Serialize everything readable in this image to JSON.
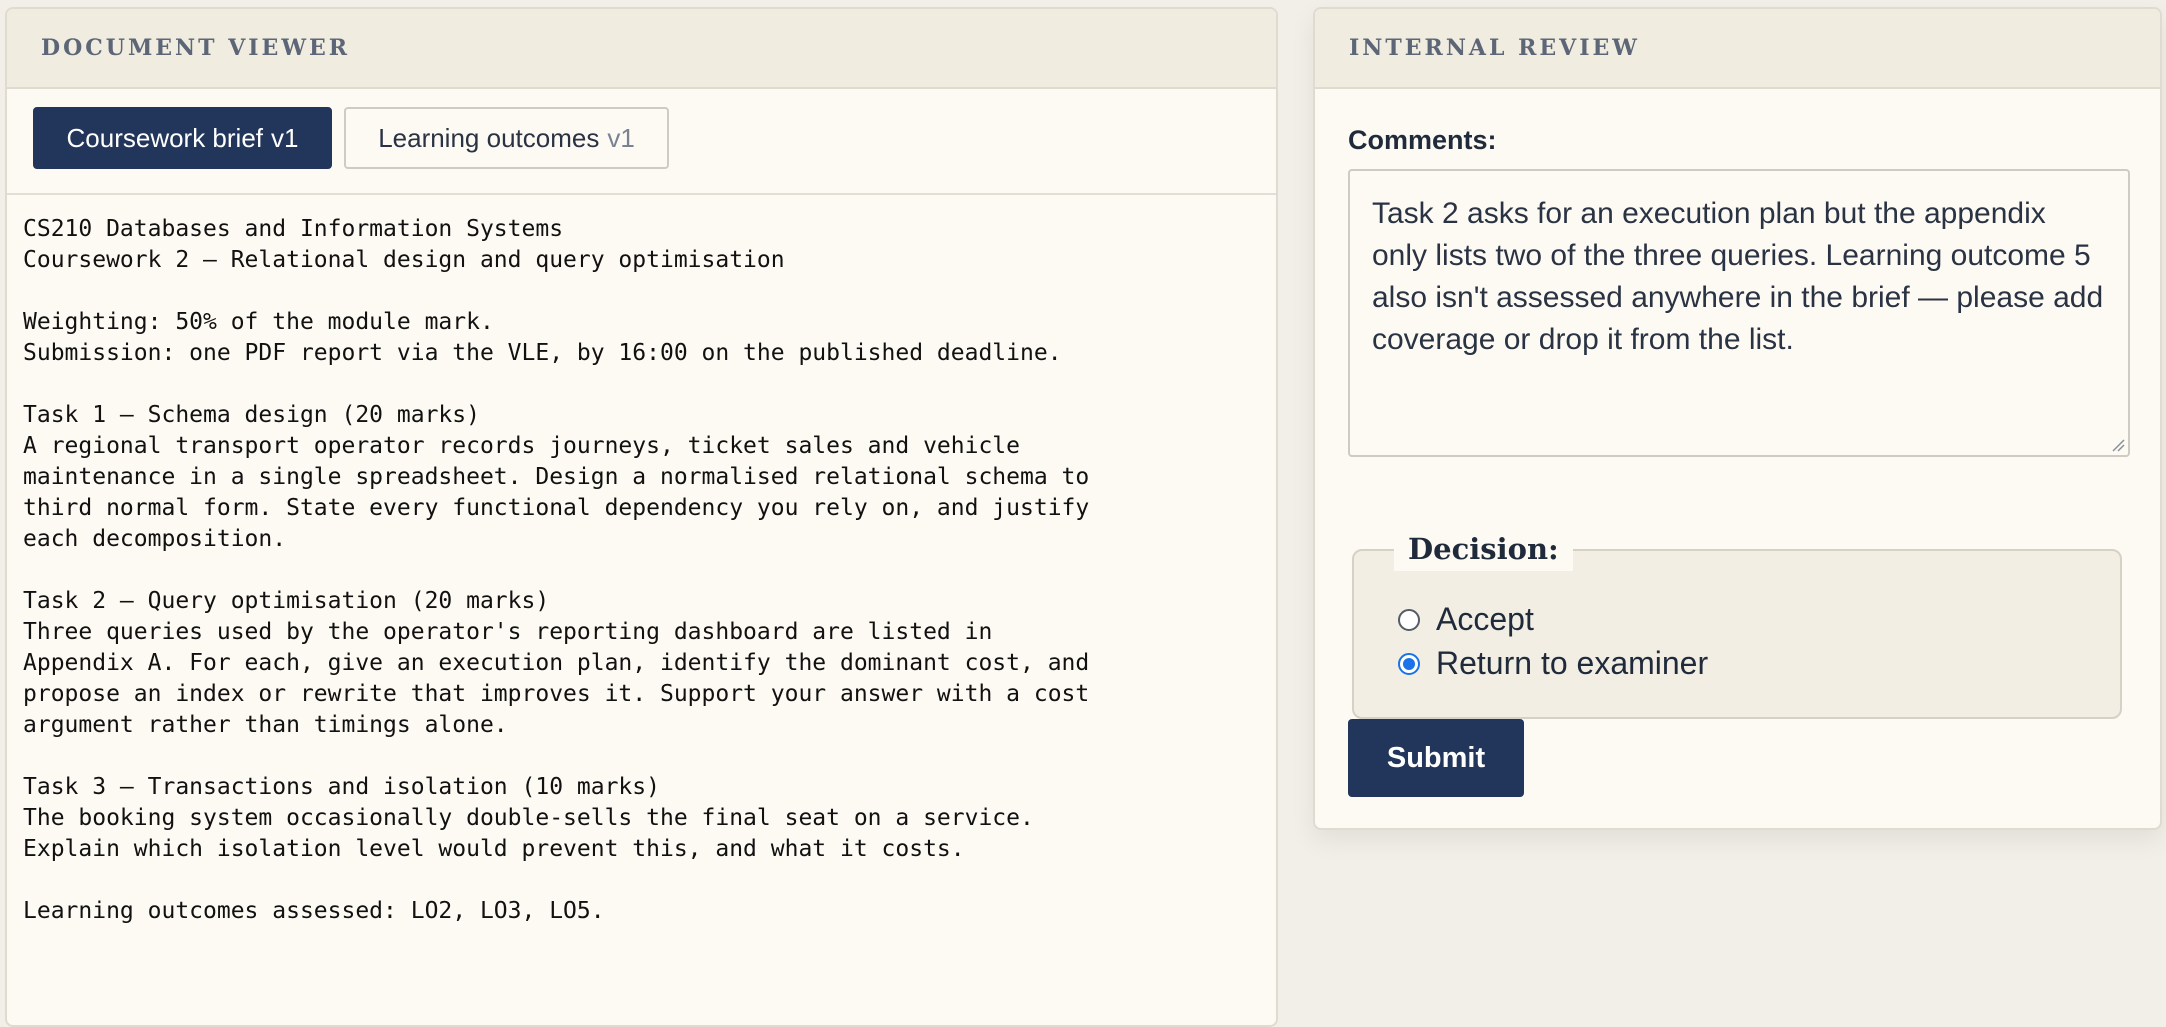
{
  "doc_viewer": {
    "title": "DOCUMENT VIEWER",
    "tabs": [
      {
        "label": "Coursework brief",
        "version": "v1",
        "active": true
      },
      {
        "label": "Learning outcomes",
        "version": "v1",
        "active": false
      }
    ],
    "content": "CS210 Databases and Information Systems\nCoursework 2 — Relational design and query optimisation\n\nWeighting: 50% of the module mark.\nSubmission: one PDF report via the VLE, by 16:00 on the published deadline.\n\nTask 1 — Schema design (20 marks)\nA regional transport operator records journeys, ticket sales and vehicle\nmaintenance in a single spreadsheet. Design a normalised relational schema to\nthird normal form. State every functional dependency you rely on, and justify\neach decomposition.\n\nTask 2 — Query optimisation (20 marks)\nThree queries used by the operator's reporting dashboard are listed in\nAppendix A. For each, give an execution plan, identify the dominant cost, and\npropose an index or rewrite that improves it. Support your answer with a cost\nargument rather than timings alone.\n\nTask 3 — Transactions and isolation (10 marks)\nThe booking system occasionally double-sells the final seat on a service.\nExplain which isolation level would prevent this, and what it costs.\n\nLearning outcomes assessed: LO2, LO3, LO5."
  },
  "review": {
    "title": "INTERNAL REVIEW",
    "comments_label": "Comments:",
    "comments_value": "Task 2 asks for an execution plan but the appendix only lists two of the three queries. Learning outcome 5 also isn't assessed anywhere in the brief — please add coverage or drop it from the list.",
    "decision": {
      "legend": "Decision:",
      "options": [
        {
          "label": "Accept",
          "checked": false
        },
        {
          "label": "Return to examiner",
          "checked": true
        }
      ]
    },
    "submit_label": "Submit"
  },
  "colors": {
    "page_bg": "#f2efe8",
    "panel_bg": "#fdfaf3",
    "header_bg": "#f1ece0",
    "accent_navy": "#22355a",
    "radio_selected": "#1a73e8"
  }
}
